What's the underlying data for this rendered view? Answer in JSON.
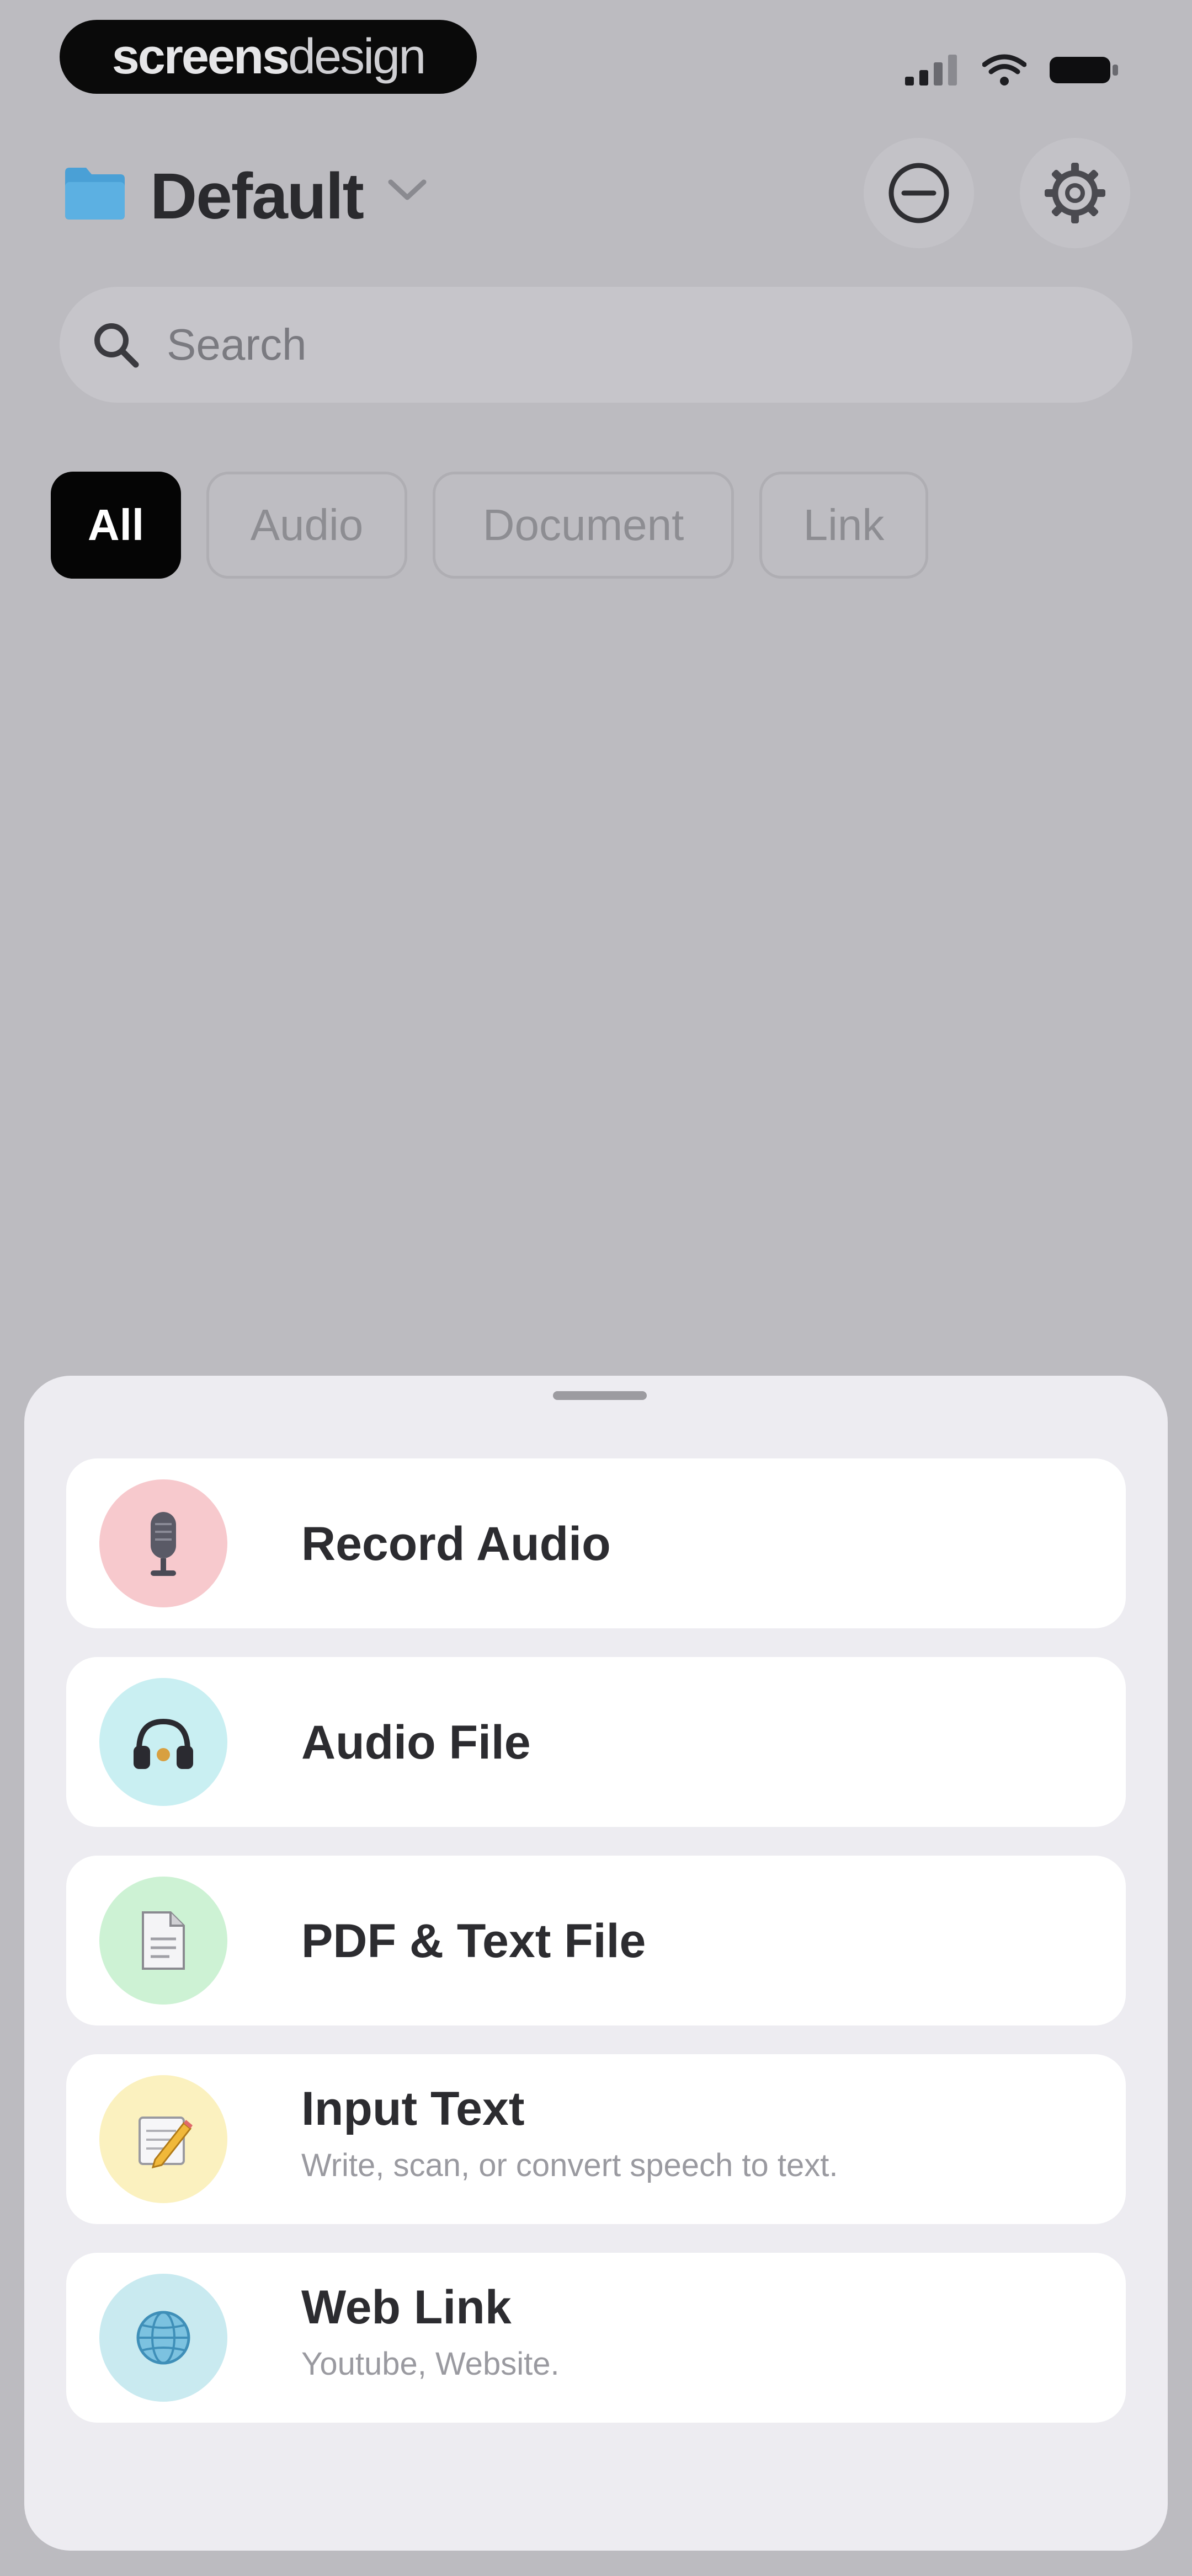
{
  "status_bar": {
    "brand_bold": "screens",
    "brand_light": "design"
  },
  "header": {
    "folder_title": "Default",
    "folder_icon": "folder-icon",
    "icons": [
      "minus-circle-icon",
      "gear-icon"
    ]
  },
  "search": {
    "placeholder": "Search"
  },
  "filters": {
    "selected": "All",
    "chips": [
      {
        "label": "All"
      },
      {
        "label": "Audio"
      },
      {
        "label": "Document"
      },
      {
        "label": "Link"
      }
    ]
  },
  "sheet": {
    "options": [
      {
        "title": "Record Audio",
        "subtitle": "",
        "icon": "microphone-icon",
        "icon_bg": "#f7c9cd"
      },
      {
        "title": "Audio File",
        "subtitle": "",
        "icon": "headphones-icon",
        "icon_bg": "#c9eff2"
      },
      {
        "title": "PDF & Text File",
        "subtitle": "",
        "icon": "document-icon",
        "icon_bg": "#cdf2d4"
      },
      {
        "title": "Input Text",
        "subtitle": "Write, scan, or convert speech to text.",
        "icon": "memo-pencil-icon",
        "icon_bg": "#fbf1bf"
      },
      {
        "title": "Web Link",
        "subtitle": "Youtube, Website.",
        "icon": "globe-icon",
        "icon_bg": "#c9eaf0"
      }
    ]
  },
  "colors": {
    "background_dimmed": "#bcbbc0",
    "sheet_background": "#edecf1",
    "active_chip": "#050505",
    "folder_blue": "#4aa0d6"
  }
}
